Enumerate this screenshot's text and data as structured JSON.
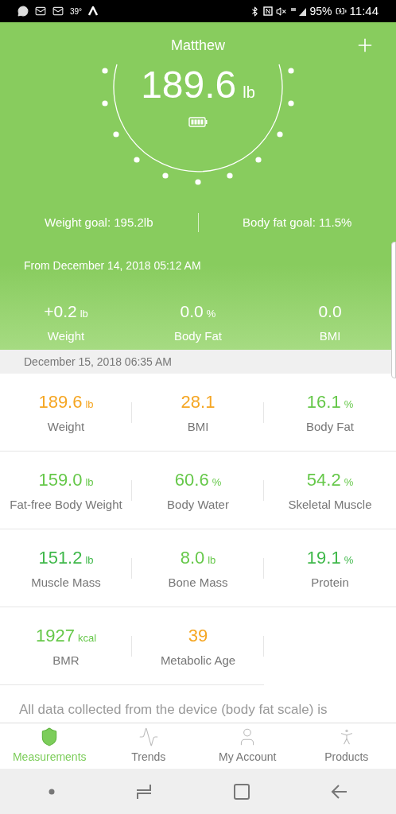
{
  "status_bar": {
    "temperature": "39°",
    "battery": "95%",
    "time": "11:44"
  },
  "header": {
    "user": "Matthew",
    "weight": {
      "value": "189.6",
      "unit": "lb"
    },
    "weight_goal": "Weight goal: 195.2lb",
    "body_fat_goal": "Body fat goal: 11.5%",
    "since": "From December 14, 2018 05:12 AM",
    "changes": [
      {
        "value": "+0.2",
        "unit": "lb",
        "label": "Weight"
      },
      {
        "value": "0.0",
        "unit": "%",
        "label": "Body Fat"
      },
      {
        "value": "0.0",
        "label": "BMI"
      }
    ]
  },
  "date": "December 15, 2018 06:35 AM",
  "metrics": [
    {
      "value": "189.6",
      "unit": "lb",
      "label": "Weight",
      "color": "#f5a623"
    },
    {
      "value": "28.1",
      "label": "BMI",
      "color": "#f5a623"
    },
    {
      "value": "16.1",
      "unit": "%",
      "label": "Body Fat",
      "color": "#66c84a"
    },
    {
      "value": "159.0",
      "unit": "lb",
      "label": "Fat-free Body Weight",
      "color": "#66c84a"
    },
    {
      "value": "60.6",
      "unit": "%",
      "label": "Body Water",
      "color": "#66c84a"
    },
    {
      "value": "54.2",
      "unit": "%",
      "label": "Skeletal Muscle",
      "color": "#66c84a"
    },
    {
      "value": "151.2",
      "unit": "lb",
      "label": "Muscle Mass",
      "color": "#3fb84a"
    },
    {
      "value": "8.0",
      "unit": "lb",
      "label": "Bone Mass",
      "color": "#66c84a"
    },
    {
      "value": "19.1",
      "unit": "%",
      "label": "Protein",
      "color": "#3fb84a"
    },
    {
      "value": "1927",
      "unit": "kcal",
      "label": "BMR",
      "color": "#66c84a"
    },
    {
      "value": "39",
      "label": "Metabolic Age",
      "color": "#f5a623"
    }
  ],
  "note": "All data collected from the device (body fat scale) is",
  "tabs": [
    {
      "label": "Measurements",
      "selected": true
    },
    {
      "label": "Trends",
      "selected": false
    },
    {
      "label": "My Account",
      "selected": false
    },
    {
      "label": "Products",
      "selected": false
    }
  ]
}
